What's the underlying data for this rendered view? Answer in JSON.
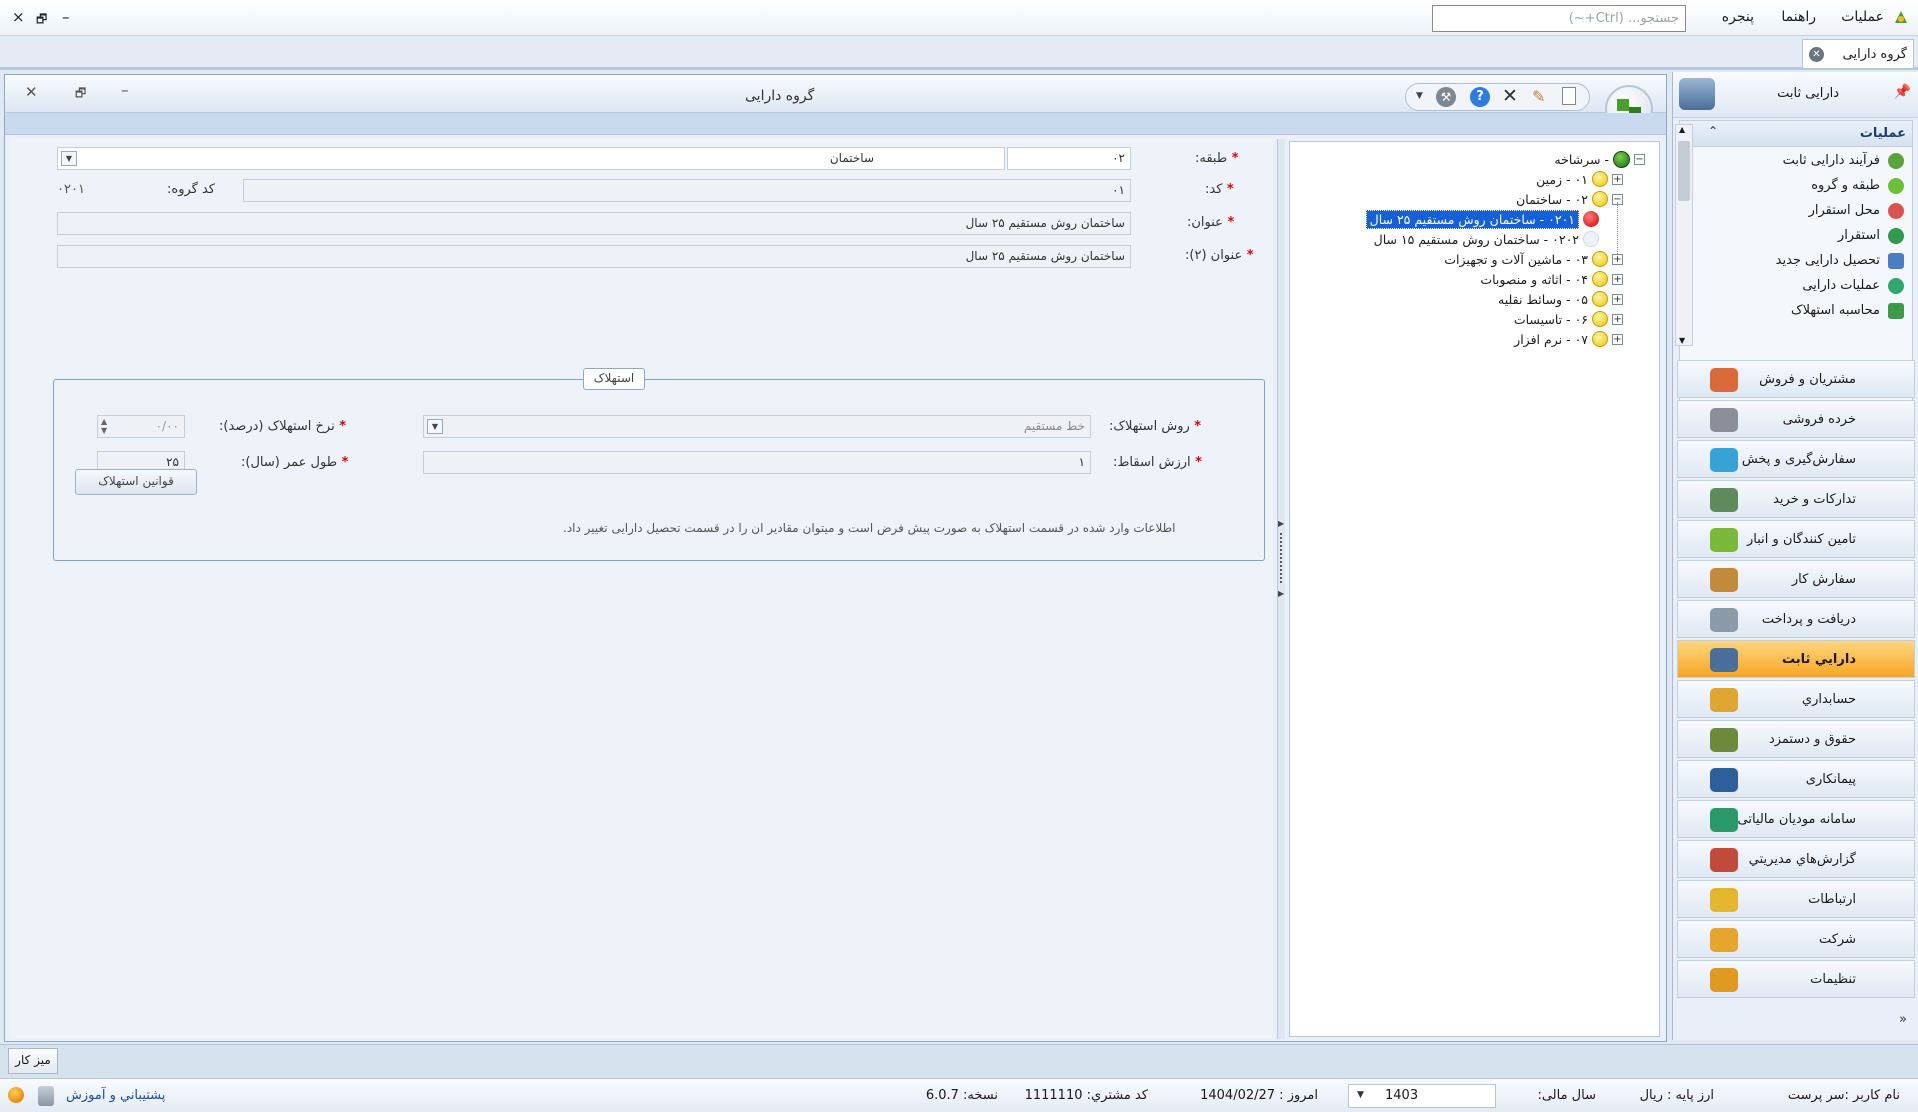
{
  "menu": {
    "items": [
      "عملیات",
      "راهنما",
      "پنجره"
    ],
    "search_placeholder": "جستجو... (Ctrl+~)",
    "window_controls": [
      "×",
      "🗗",
      "–"
    ]
  },
  "tabs": [
    {
      "label": "گروه دارایی"
    }
  ],
  "window": {
    "title": "گروه دارایی"
  },
  "nav": {
    "header_title": "دارایی ثابت",
    "operations_title": "عملیات",
    "operations": [
      {
        "label": "فرآیند دارایی ثابت",
        "icon": "process-icon",
        "color": "#5aa43a"
      },
      {
        "label": "طبقه و گروه",
        "icon": "category-icon",
        "color": "#6bbf3a"
      },
      {
        "label": "محل استقرار",
        "icon": "location-icon",
        "color": "#d9534f"
      },
      {
        "label": "استقرار",
        "icon": "deploy-icon",
        "color": "#2e9b4f"
      },
      {
        "label": "تحصیل دارایی جدید",
        "icon": "acquire-icon",
        "color": "#4a7ec2"
      },
      {
        "label": "عملیات دارایی",
        "icon": "asset-ops-icon",
        "color": "#2fa86b"
      },
      {
        "label": "محاسبه استهلاک",
        "icon": "calc-icon",
        "color": "#3d9b47"
      }
    ],
    "modules": [
      {
        "label": "مشتریان و فروش",
        "icon": "sales-icon",
        "color": "#d96b3a"
      },
      {
        "label": "خرده فروشی",
        "icon": "retail-icon",
        "color": "#8a8f99"
      },
      {
        "label": "سفارش‌گیری و پخش",
        "icon": "distribution-icon",
        "color": "#37a2d6"
      },
      {
        "label": "تدارکات و خرید",
        "icon": "purchase-icon",
        "color": "#5f8a5a"
      },
      {
        "label": "تامین کنندگان و انبار",
        "icon": "supplier-icon",
        "color": "#7ab83a"
      },
      {
        "label": "سفارش کار",
        "icon": "workorder-icon",
        "color": "#c28a3a"
      },
      {
        "label": "دریافت و پرداخت",
        "icon": "payment-icon",
        "color": "#8b9aa8"
      },
      {
        "label": "دارايي ثابت",
        "icon": "fixed-asset-icon",
        "color": "#4a6e9a",
        "active": true
      },
      {
        "label": "حسابداري",
        "icon": "accounting-icon",
        "color": "#e0a533"
      },
      {
        "label": "حقوق و دستمزد",
        "icon": "payroll-icon",
        "color": "#6d8a3a"
      },
      {
        "label": "پیمانکاری",
        "icon": "contracting-icon",
        "color": "#2d5f9a"
      },
      {
        "label": "سامانه مودیان مالیاتی",
        "icon": "tax-icon",
        "color": "#2a9a6a"
      },
      {
        "label": "گزارش‌هاي مديريتي",
        "icon": "reports-icon",
        "color": "#c24a3a"
      },
      {
        "label": "ارتباطات",
        "icon": "communication-icon",
        "color": "#e6b62e"
      },
      {
        "label": "شرکت",
        "icon": "company-icon",
        "color": "#e6a62e"
      },
      {
        "label": "تنظیمات",
        "icon": "settings-icon",
        "color": "#e09a20"
      }
    ]
  },
  "form": {
    "class_label": "طبقه:",
    "class_code": "۰۲",
    "class_name": "ساختمان",
    "code_label": "کد:",
    "code_value": "۰۱",
    "group_code_label": "کد گروه:",
    "group_code_value": "۰۲۰۱",
    "title_label": "عنوان:",
    "title_value": "ساختمان روش مستقیم ۲۵ سال",
    "title2_label": "عنوان (۲):",
    "title2_value": "ساختمان روش مستقیم ۲۵ سال",
    "depreciation": {
      "legend": "استهلاک",
      "method_label": "روش استهلاک:",
      "method_value": "خط مستقیم",
      "rate_label": "نرخ استهلاک (درصد):",
      "rate_value": "۰/۰۰",
      "salvage_label": "ارزش اسقاط:",
      "salvage_value": "۱",
      "life_label": "طول عمر (سال):",
      "life_value": "۲۵",
      "rules_button": "قوانین استهلاک",
      "note": "اطلاعات وارد شده در قسمت استهلاک به صورت پیش فرض است  و میتوان مقادیر ان را در قسمت تحصیل دارایی تغییر داد."
    }
  },
  "tree": {
    "root": "- سرشاخه",
    "nodes": [
      {
        "label": "۰۱ - زمین"
      },
      {
        "label": "۰۲ - ساختمان"
      },
      {
        "label": "۰۲۰۱ - ساختمان روش مستقیم ۲۵ سال",
        "selected": true
      },
      {
        "label": "۰۲۰۲ - ساختمان روش مستقیم ۱۵ سال"
      },
      {
        "label": "۰۳ - ماشین آلات و تجهیزات"
      },
      {
        "label": "۰۴ - اثاثه و منصوبات"
      },
      {
        "label": "۰۵ - وسائط نقلیه"
      },
      {
        "label": "۰۶ - تاسیسات"
      },
      {
        "label": "۰۷ - نرم افزار"
      }
    ]
  },
  "desk_tab": "میز کار",
  "status": {
    "user": "نام کاربر :سر پرست",
    "currency": "ارز پایه :   ریال",
    "fiscal_label": "سال مالی:",
    "fiscal_year": "1403",
    "today": "امروز :    1404/02/27",
    "customer_code": "کد مشتري:    1111110",
    "version": "نسخه:    6.0.7",
    "support": "پشتيباني و آموزش"
  }
}
